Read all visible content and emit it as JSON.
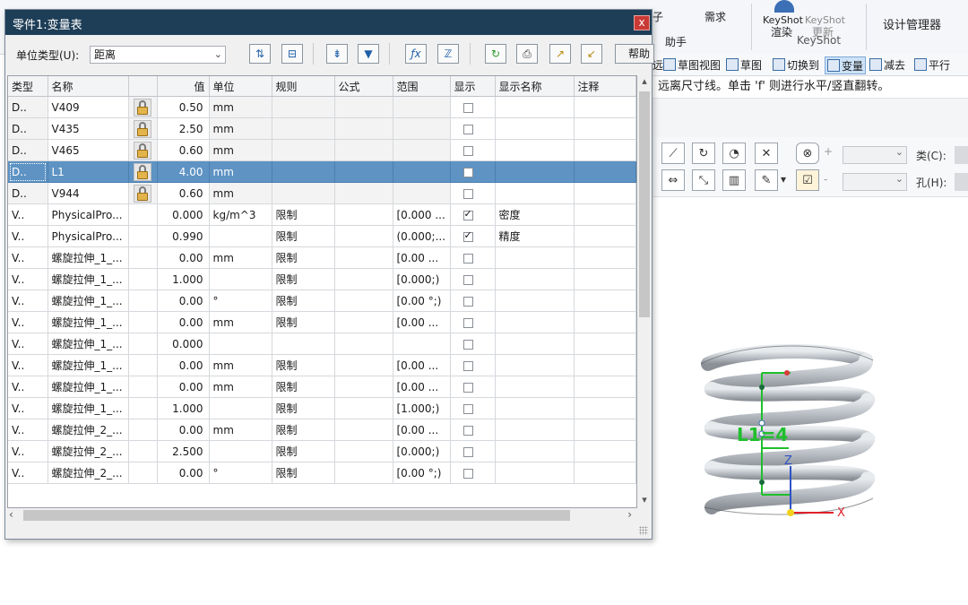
{
  "ribbon": {
    "help_group": "助手",
    "require": "需求",
    "keyshot_render": "渲染",
    "keyshot_update": "更新",
    "keyshot_group": "KeyShot",
    "keyshot_label_a": "KeyShot",
    "keyshot_label_b": "KeyShot",
    "design_manager": "设计管理器",
    "partial_a": "子"
  },
  "commandbar": {
    "items": [
      {
        "label": "远",
        "name": "cmd-distance"
      },
      {
        "label": "草图视图",
        "name": "cmd-sketch-view"
      },
      {
        "label": "草图",
        "name": "cmd-sketch"
      },
      {
        "label": "切换到",
        "name": "cmd-switch-to"
      },
      {
        "label": "变量",
        "name": "cmd-variables"
      },
      {
        "label": "减去",
        "name": "cmd-subtract"
      },
      {
        "label": "平行",
        "name": "cmd-parallel"
      }
    ]
  },
  "prompt": "远离尺寸线。单击 'f' 则进行水平/竖直翻转。",
  "sketchbar": {
    "class_label": "类(C):",
    "hole_label": "孔(H):"
  },
  "dialog": {
    "title": "零件1:变量表",
    "close_glyph": "x",
    "unit_type_label": "单位类型(U):",
    "unit_type_value": "距离",
    "help_label": "帮助"
  },
  "table": {
    "headers": [
      "类型",
      "名称",
      "",
      "值",
      "单位",
      "规则",
      "公式",
      "范围",
      "显示",
      "显示名称",
      "注释"
    ],
    "rows": [
      {
        "type": "D..",
        "name": "V409",
        "lock": true,
        "value": "0.50",
        "unit": "mm",
        "rule": "",
        "formula": "",
        "range": "",
        "show": false,
        "show_name": "",
        "note": ""
      },
      {
        "type": "D..",
        "name": "V435",
        "lock": true,
        "value": "2.50",
        "unit": "mm",
        "rule": "",
        "formula": "",
        "range": "",
        "show": false,
        "show_name": "",
        "note": ""
      },
      {
        "type": "D..",
        "name": "V465",
        "lock": true,
        "value": "0.60",
        "unit": "mm",
        "rule": "",
        "formula": "",
        "range": "",
        "show": false,
        "show_name": "",
        "note": ""
      },
      {
        "type": "D..",
        "name": "L1",
        "lock": true,
        "value": "4.00",
        "unit": "mm",
        "rule": "",
        "formula": "",
        "range": "",
        "show": false,
        "show_name": "",
        "note": "",
        "selected": true
      },
      {
        "type": "D..",
        "name": "V944",
        "lock": true,
        "value": "0.60",
        "unit": "mm",
        "rule": "",
        "formula": "",
        "range": "",
        "show": false,
        "show_name": "",
        "note": ""
      },
      {
        "type": "V..",
        "name": "PhysicalPro...",
        "lock": false,
        "value": "0.000",
        "unit": "kg/m^3",
        "rule": "限制",
        "formula": "",
        "range": "[0.000 ...",
        "show": true,
        "show_name": "密度",
        "note": ""
      },
      {
        "type": "V..",
        "name": "PhysicalPro...",
        "lock": false,
        "value": "0.990",
        "unit": "",
        "rule": "限制",
        "formula": "",
        "range": "(0.000;...",
        "show": true,
        "show_name": "精度",
        "note": ""
      },
      {
        "type": "V..",
        "name": "螺旋拉伸_1_...",
        "lock": false,
        "value": "0.00",
        "unit": "mm",
        "rule": "限制",
        "formula": "",
        "range": "[0.00 ...",
        "show": false,
        "show_name": "",
        "note": ""
      },
      {
        "type": "V..",
        "name": "螺旋拉伸_1_...",
        "lock": false,
        "value": "1.000",
        "unit": "",
        "rule": "限制",
        "formula": "",
        "range": "[0.000;)",
        "show": false,
        "show_name": "",
        "note": ""
      },
      {
        "type": "V..",
        "name": "螺旋拉伸_1_...",
        "lock": false,
        "value": "0.00",
        "unit": "°",
        "rule": "限制",
        "formula": "",
        "range": "[0.00 °;)",
        "show": false,
        "show_name": "",
        "note": ""
      },
      {
        "type": "V..",
        "name": "螺旋拉伸_1_...",
        "lock": false,
        "value": "0.00",
        "unit": "mm",
        "rule": "限制",
        "formula": "",
        "range": "[0.00 ...",
        "show": false,
        "show_name": "",
        "note": ""
      },
      {
        "type": "V..",
        "name": "螺旋拉伸_1_...",
        "lock": false,
        "value": "0.000",
        "unit": "",
        "rule": "",
        "formula": "",
        "range": "",
        "show": false,
        "show_name": "",
        "note": ""
      },
      {
        "type": "V..",
        "name": "螺旋拉伸_1_...",
        "lock": false,
        "value": "0.00",
        "unit": "mm",
        "rule": "限制",
        "formula": "",
        "range": "[0.00 ...",
        "show": false,
        "show_name": "",
        "note": ""
      },
      {
        "type": "V..",
        "name": "螺旋拉伸_1_...",
        "lock": false,
        "value": "0.00",
        "unit": "mm",
        "rule": "限制",
        "formula": "",
        "range": "[0.00 ...",
        "show": false,
        "show_name": "",
        "note": ""
      },
      {
        "type": "V..",
        "name": "螺旋拉伸_1_...",
        "lock": false,
        "value": "1.000",
        "unit": "",
        "rule": "限制",
        "formula": "",
        "range": "[1.000;)",
        "show": false,
        "show_name": "",
        "note": ""
      },
      {
        "type": "V..",
        "name": "螺旋拉伸_2_...",
        "lock": false,
        "value": "0.00",
        "unit": "mm",
        "rule": "限制",
        "formula": "",
        "range": "[0.00 ...",
        "show": false,
        "show_name": "",
        "note": ""
      },
      {
        "type": "V..",
        "name": "螺旋拉伸_2_...",
        "lock": false,
        "value": "2.500",
        "unit": "",
        "rule": "限制",
        "formula": "",
        "range": "[0.000;)",
        "show": false,
        "show_name": "",
        "note": ""
      },
      {
        "type": "V..",
        "name": "螺旋拉伸_2_...",
        "lock": false,
        "value": "0.00",
        "unit": "°",
        "rule": "限制",
        "formula": "",
        "range": "[0.00 °;)",
        "show": false,
        "show_name": "",
        "note": ""
      }
    ]
  },
  "viewport": {
    "dim_label": "L1=4",
    "axis_x": "X",
    "axis_z": "Z"
  },
  "colors": {
    "titlebar": "#1e3e57",
    "selection": "#5e93c4",
    "close": "#c93a35",
    "dimension": "#1fbf2c",
    "spring": "#b9bec4"
  }
}
